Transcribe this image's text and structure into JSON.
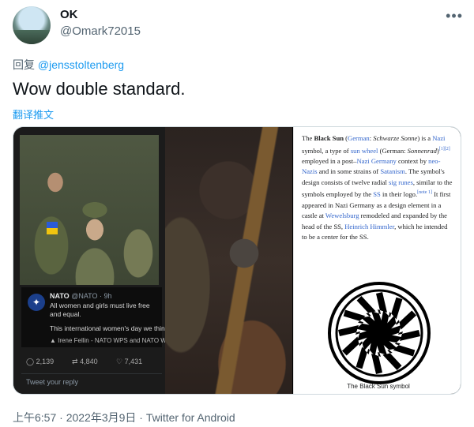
{
  "user": {
    "name": "OK",
    "handle": "@Omark72015"
  },
  "reply": {
    "prefix": "回复",
    "mention": "@jensstoltenberg"
  },
  "tweet": {
    "text": "Wow double standard.",
    "translate": "翻译推文"
  },
  "embedded_nato": {
    "name": "NATO",
    "meta": "@NATO · 9h",
    "text": "All women and girls must live free and equal.",
    "subtext": "This international women's day we think...",
    "credit": "Irene Fellin - NATO WPS and NATO WPS",
    "replies": "2,139",
    "retweets": "4,840",
    "likes": "7,431",
    "reply_placeholder": "Tweet your reply"
  },
  "wiki": {
    "t1": "The ",
    "t2": "Black Sun",
    "t3": " (",
    "t4": "German",
    "t5": ": ",
    "t6": "Schwarze Sonne",
    "t7": ") is a ",
    "t8": "Nazi",
    "t9": " symbol, a type of ",
    "t10": "sun wheel",
    "t11": " (German: ",
    "t12": "Sonnenrad",
    "t13": ")",
    "sup1": "[1][2]",
    "t14": " employed in a post–",
    "t15": "Nazi Germany",
    "t16": " context by ",
    "t17": "neo-Nazis",
    "t18": " and in some strains of ",
    "t19": "Satanism",
    "t20": ". The symbol's design consists of twelve radial ",
    "t21": "sig runes",
    "t22": ", similar to the symbols employed by the ",
    "t23": "SS",
    "t24": " in their logo.",
    "sup2": "[note 1]",
    "t25": " It first appeared in Nazi Germany as a design element in a castle at ",
    "t26": "Wewelsburg",
    "t27": " remodeled and expanded by the head of the SS, ",
    "t28": "Heinrich Himmler",
    "t29": ", which he intended to be a center for the SS.",
    "caption": "The Black Sun symbol"
  },
  "footer": {
    "text": "上午6:57 · 2022年3月9日 · Twitter for Android"
  },
  "colors": {
    "link": "#1d9bf0",
    "wiki_link": "#3366cc",
    "muted": "#536471"
  }
}
